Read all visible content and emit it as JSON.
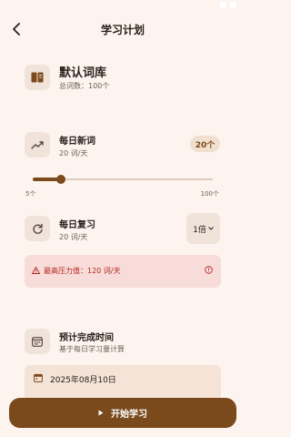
{
  "header": {
    "title": "学习计划"
  },
  "library": {
    "name": "默认词库",
    "total_words": "总词数：100个"
  },
  "daily_new": {
    "title": "每日新词",
    "subtitle": "20 词/天",
    "badge": "20个"
  },
  "slider": {
    "min_label": "5个",
    "max_label": "100个",
    "min": 5,
    "max": 100,
    "value": 20
  },
  "daily_review": {
    "title": "每日复习",
    "subtitle": "20 词/天",
    "multiplier": "1倍"
  },
  "warning": {
    "text": "最高压力值：120 词/天"
  },
  "finish": {
    "title": "预计完成时间",
    "subtitle": "基于每日学习量计算",
    "date": "2025年08月10日"
  },
  "start_button": {
    "label": "开始学习"
  },
  "colors": {
    "accent": "#7a4a1c",
    "background": "#fdf4ef",
    "warning_bg": "#f7dcd9",
    "warning_fg": "#b3261e"
  }
}
